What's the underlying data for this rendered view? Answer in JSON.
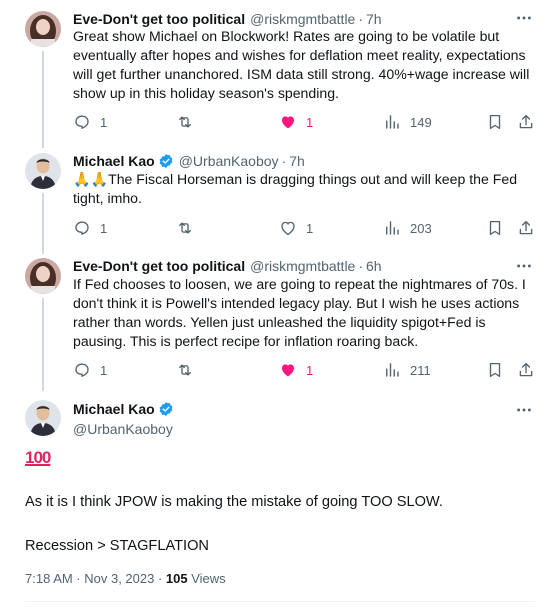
{
  "tweets": [
    {
      "name": "Eve-Don't get too political",
      "handle": "@riskmgmtbattle",
      "time": "7h",
      "text": "Great show Michael on Blockwork! Rates are going to be volatile but eventually after hopes and wishes for deflation meet reality, expectations will get further unanchored. ISM data still strong. 40%+wage increase will show up in this holiday season's spending.",
      "replies": "1",
      "retweets": "",
      "likes": "1",
      "views": "149",
      "liked": true
    },
    {
      "name": "Michael Kao",
      "handle": "@UrbanKaoboy",
      "time": "7h",
      "text": "🙏🙏The Fiscal Horseman is dragging things out and will keep the Fed tight, imho.",
      "replies": "1",
      "retweets": "",
      "likes": "1",
      "views": "203",
      "liked": false
    },
    {
      "name": "Eve-Don't get too political",
      "handle": "@riskmgmtbattle",
      "time": "6h",
      "text": "If Fed chooses to loosen, we are going to repeat the nightmares of 70s. I don't think it is Powell's intended legacy play. But I wish he uses actions rather than words. Yellen just unleashed the liquidity spigot+Fed is pausing. This is perfect recipe for inflation roaring back.",
      "replies": "1",
      "retweets": "",
      "likes": "1",
      "views": "211",
      "liked": true
    }
  ],
  "main": {
    "name": "Michael Kao",
    "handle": "@UrbanKaoboy",
    "emoji": "100",
    "line1": "As it is I think JPOW is making the mistake of going TOO SLOW.",
    "line2": "Recession > STAGFLATION",
    "timestamp": "7:18 AM · Nov 3, 2023 · ",
    "views_count": "105",
    "views_label": " Views"
  },
  "colors": {
    "text": "#0f1419",
    "secondary": "#536471",
    "like": "#f91880",
    "verified": "#1d9bf0"
  },
  "icons": [
    "reply-icon",
    "retweet-icon",
    "heart-icon",
    "views-icon",
    "bookmark-icon",
    "share-icon",
    "more-icon",
    "verified-icon"
  ]
}
